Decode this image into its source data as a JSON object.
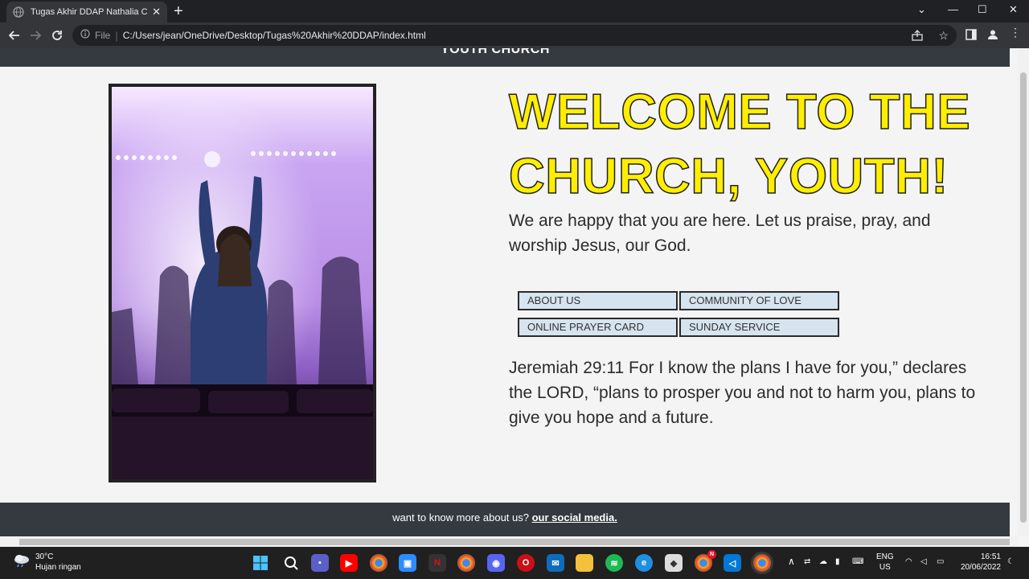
{
  "browser": {
    "tab_title": "Tugas Akhir DDAP Nathalia Claris",
    "file_label": "File",
    "url": "C:/Users/jean/OneDrive/Desktop/Tugas%20Akhir%20DDAP/index.html"
  },
  "page": {
    "header_title": "YOUTH CHURCH",
    "welcome": "WELCOME TO THE CHURCH, YOUTH!",
    "intro": "We are happy that you are here. Let us praise, pray, and worship Jesus, our God.",
    "buttons": [
      "ABOUT US",
      "COMMUNITY OF LOVE",
      "ONLINE PRAYER CARD",
      "SUNDAY SERVICE"
    ],
    "verse": "Jeremiah 29:11 For I know the plans I have for you,” declares the LORD, “plans to prosper you and not to harm you, plans to give you hope and a future.",
    "footer_text": "want to know more about us? ",
    "footer_link": "our social media."
  },
  "taskbar": {
    "temperature": "30°C",
    "weather": "Hujan ringan",
    "lang": "ENG",
    "region": "US",
    "time": "16:51",
    "date": "20/06/2022",
    "badge": "N"
  },
  "colors": {
    "accent": "#ffee00",
    "header": "#343a40",
    "button": "#d6e4f0"
  }
}
